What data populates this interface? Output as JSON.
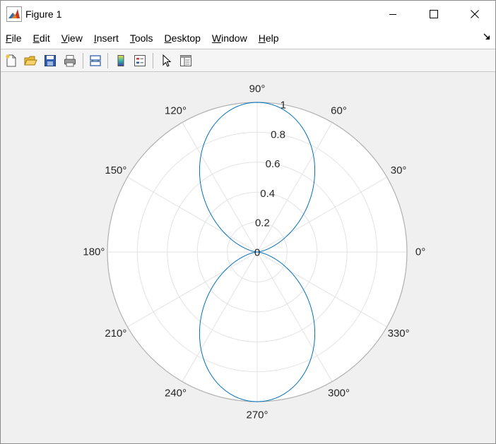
{
  "window": {
    "title": "Figure 1"
  },
  "menu": [
    {
      "mnemonic": "F",
      "rest": "ile",
      "name": "menu-file"
    },
    {
      "mnemonic": "E",
      "rest": "dit",
      "name": "menu-edit"
    },
    {
      "mnemonic": "V",
      "rest": "iew",
      "name": "menu-view"
    },
    {
      "mnemonic": "I",
      "rest": "nsert",
      "name": "menu-insert"
    },
    {
      "mnemonic": "T",
      "rest": "ools",
      "name": "menu-tools"
    },
    {
      "mnemonic": "D",
      "rest": "esktop",
      "name": "menu-desktop"
    },
    {
      "mnemonic": "W",
      "rest": "indow",
      "name": "menu-window"
    },
    {
      "mnemonic": "H",
      "rest": "elp",
      "name": "menu-help"
    }
  ],
  "toolbar": [
    {
      "icon": "new-figure-icon"
    },
    {
      "icon": "open-file-icon"
    },
    {
      "icon": "save-icon"
    },
    {
      "icon": "print-icon"
    },
    {
      "icon": "link-plot-icon"
    },
    {
      "icon": "colorbar-icon"
    },
    {
      "icon": "legend-icon"
    },
    {
      "icon": "edit-plot-pointer-icon"
    },
    {
      "icon": "property-inspector-icon"
    }
  ],
  "colors": {
    "trace": "#0072BD",
    "axes_bg": "#ffffff",
    "grid": "#e3e3e3",
    "outer_ring": "#b0b0b0",
    "label": "#262626"
  },
  "chart_data": {
    "type": "line",
    "coordinate_system": "polar",
    "theta_unit": "degrees",
    "series": [
      {
        "theta": [
          0,
          10,
          20,
          30,
          40,
          50,
          60,
          70,
          80,
          90,
          100,
          110,
          120,
          130,
          140,
          150,
          160,
          170,
          180,
          190,
          200,
          210,
          220,
          230,
          240,
          250,
          260,
          270,
          280,
          290,
          300,
          310,
          320,
          330,
          340,
          350,
          360
        ],
        "r": [
          0,
          0.03,
          0.117,
          0.25,
          0.413,
          0.587,
          0.75,
          0.883,
          0.97,
          1,
          0.97,
          0.883,
          0.75,
          0.587,
          0.413,
          0.25,
          0.117,
          0.03,
          0,
          0.03,
          0.117,
          0.25,
          0.413,
          0.587,
          0.75,
          0.883,
          0.97,
          1,
          0.97,
          0.883,
          0.75,
          0.587,
          0.413,
          0.25,
          0.117,
          0.03,
          0
        ]
      }
    ],
    "theta_ticks": [
      0,
      30,
      60,
      90,
      120,
      150,
      180,
      210,
      240,
      270,
      300,
      330
    ],
    "theta_tick_labels": [
      "0°",
      "30°",
      "60°",
      "90°",
      "120°",
      "150°",
      "180°",
      "210°",
      "240°",
      "270°",
      "300°",
      "330°"
    ],
    "r_ticks": [
      0,
      0.2,
      0.4,
      0.6,
      0.8,
      1
    ],
    "r_tick_labels": [
      "0",
      "0.2",
      "0.4",
      "0.6",
      "0.8",
      "1"
    ],
    "r_axis_angle": 80,
    "rlim": [
      0,
      1
    ],
    "grid": true
  }
}
